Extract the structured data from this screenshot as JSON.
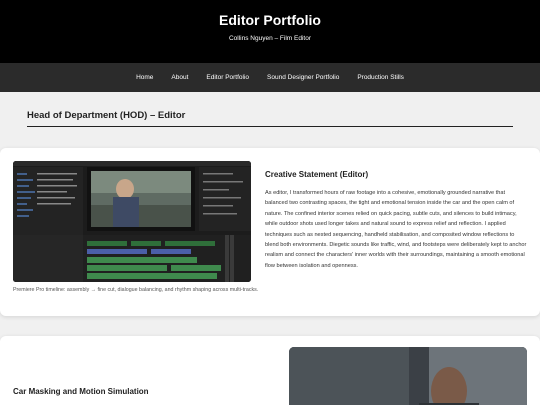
{
  "header": {
    "title": "Editor Portfolio",
    "subtitle": "Collins Nguyen – Film Editor"
  },
  "nav": {
    "items": [
      "Home",
      "About",
      "Editor Portfolio",
      "Sound Designer Portfolio",
      "Production Stills"
    ]
  },
  "section": {
    "heading": "Head of Department (HOD) – Editor"
  },
  "card1": {
    "caption": "Premiere Pro timeline: assembly → fine cut, dialogue balancing, and rhythm shaping across multi-tracks.",
    "statement_title": "Creative Statement (Editor)",
    "statement_body": "As editor, I transformed hours of raw footage into a cohesive, emotionally grounded narrative that balanced two contrasting spaces, the tight and emotional tension inside the car and the open calm of nature. The confined interior scenes relied on quick pacing, subtle cuts, and silences to build intimacy, while outdoor shots used longer takes and natural sound to express relief and reflection. I applied techniques such as nested sequencing, handheld stabilisation, and composited window reflections to blend both environments. Diegetic sounds like traffic, wind, and footsteps were deliberately kept to anchor realism and connect the characters' inner worlds with their surroundings, maintaining a smooth emotional flow between isolation and openness."
  },
  "card2": {
    "title": "Car Masking and Motion Simulation"
  }
}
